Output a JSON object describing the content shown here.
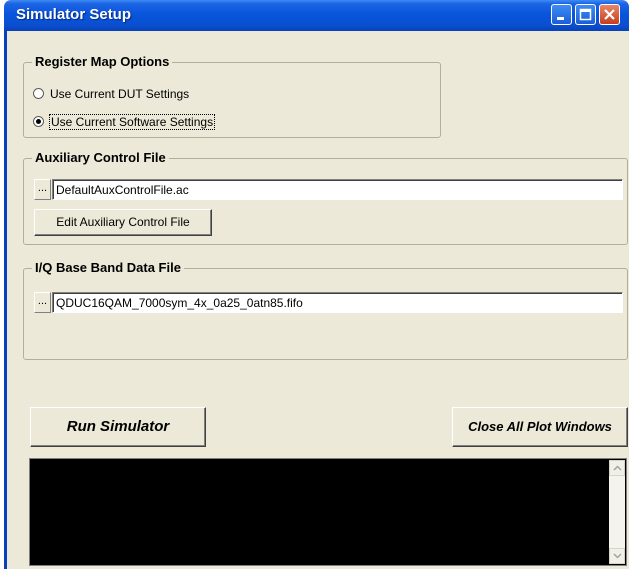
{
  "window": {
    "title": "Simulator Setup",
    "controls": {
      "minimize": "minimize-icon",
      "maximize": "maximize-icon",
      "close": "close-icon"
    }
  },
  "register_map": {
    "title": "Register Map Options",
    "options": [
      {
        "label": "Use Current DUT Settings",
        "checked": false
      },
      {
        "label": "Use Current Software Settings",
        "checked": true
      }
    ]
  },
  "aux_control": {
    "title": "Auxiliary Control File",
    "browse_label": "...",
    "file_value": "DefaultAuxControlFile.ac",
    "edit_button": "Edit Auxiliary Control File"
  },
  "iq_data": {
    "title": "I/Q Base Band Data File",
    "browse_label": "...",
    "file_value": "QDUC16QAM_7000sym_4x_0a25_0atn85.fifo"
  },
  "actions": {
    "run": "Run Simulator",
    "close_plots": "Close All Plot Windows"
  },
  "console": {
    "text": ""
  },
  "colors": {
    "titlebar": "#0855dd",
    "client_bg": "#ece9d8",
    "console_bg": "#000000",
    "close_button": "#c63e1c"
  }
}
